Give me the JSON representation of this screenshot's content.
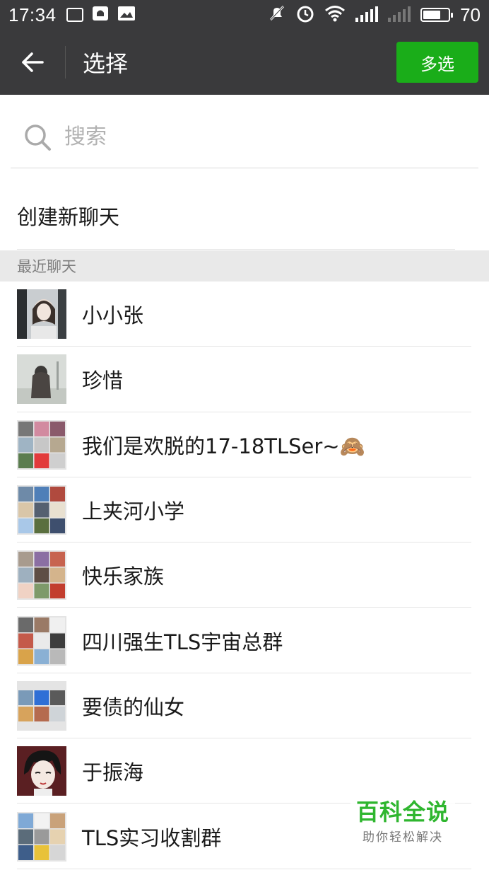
{
  "status_bar": {
    "time": "17:34",
    "battery_text": "70",
    "battery_level": 0.7,
    "icons": [
      "news-icon",
      "notification-icon",
      "image-icon",
      "mute-icon",
      "alarm-icon",
      "wifi-icon",
      "signal-icon",
      "signal-weak-icon",
      "battery-icon"
    ]
  },
  "header": {
    "title": "选择",
    "back_icon": "arrow-left-icon",
    "multi_select_label": "多选",
    "accent_color": "#1aad19"
  },
  "search": {
    "placeholder": "搜索",
    "value": "",
    "icon": "search-icon"
  },
  "new_chat_label": "创建新聊天",
  "recent_header": "最近聊天",
  "chats": [
    {
      "name": "小小张",
      "avatar": "photo-avatar"
    },
    {
      "name": "珍惜",
      "avatar": "photo-avatar"
    },
    {
      "name": "我们是欢脱的17-18TLSer~🙈",
      "avatar": "group-avatar"
    },
    {
      "name": "上夹河小学",
      "avatar": "group-avatar"
    },
    {
      "name": "快乐家族",
      "avatar": "group-avatar"
    },
    {
      "name": "四川强生TLS宇宙总群",
      "avatar": "group-avatar"
    },
    {
      "name": "要债的仙女",
      "avatar": "group-avatar"
    },
    {
      "name": "于振海",
      "avatar": "photo-avatar"
    },
    {
      "name": "TLS实习收割群",
      "avatar": "group-avatar"
    }
  ],
  "watermark": {
    "title": "百科全说",
    "subtitle": "助你轻松解决"
  }
}
